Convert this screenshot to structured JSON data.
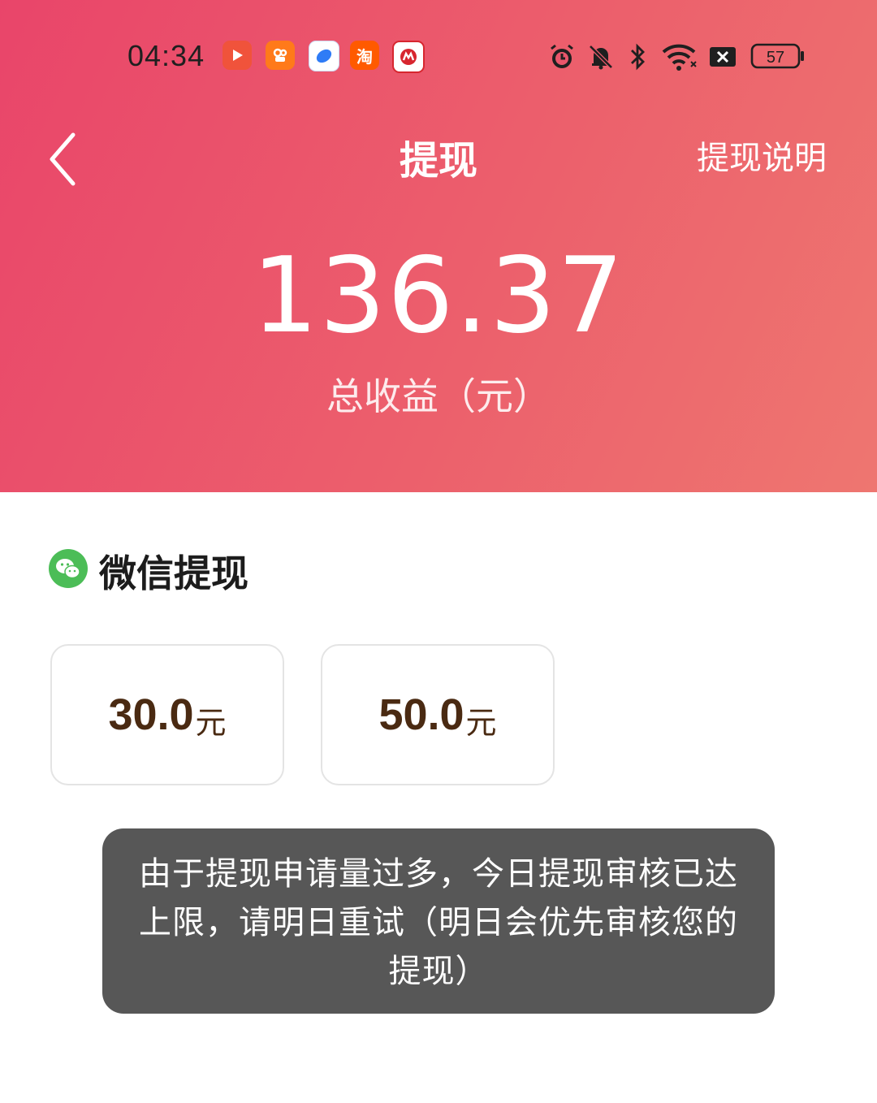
{
  "status_bar": {
    "time": "04:34",
    "apps": [
      {
        "name": "video-app-icon",
        "color": "#f0533b"
      },
      {
        "name": "kuaishou-icon",
        "color": "#ff7a1a"
      },
      {
        "name": "browser-icon",
        "color": "#2f7cf6"
      },
      {
        "name": "taobao-icon",
        "color": "#ff5a00",
        "glyph": "淘"
      },
      {
        "name": "cmb-bank-icon",
        "color": "#d7262f"
      }
    ],
    "battery": "57"
  },
  "nav": {
    "title": "提现",
    "help_link": "提现说明"
  },
  "balance": {
    "value": "136.37",
    "label": "总收益（元）"
  },
  "method": {
    "label": "微信提现",
    "icon": "wechat-icon",
    "icon_color": "#4cbd57"
  },
  "amounts": [
    {
      "value": "30.0",
      "unit": "元"
    },
    {
      "value": "50.0",
      "unit": "元"
    }
  ],
  "toast": {
    "message": "由于提现申请量过多，今日提现审核已达上限，请明日重试（明日会优先审核您的提现）"
  },
  "colors": {
    "header_start": "#e9456a",
    "header_end": "#ee7670",
    "amount_text": "#4a2a12",
    "toast_bg": "#575757"
  }
}
